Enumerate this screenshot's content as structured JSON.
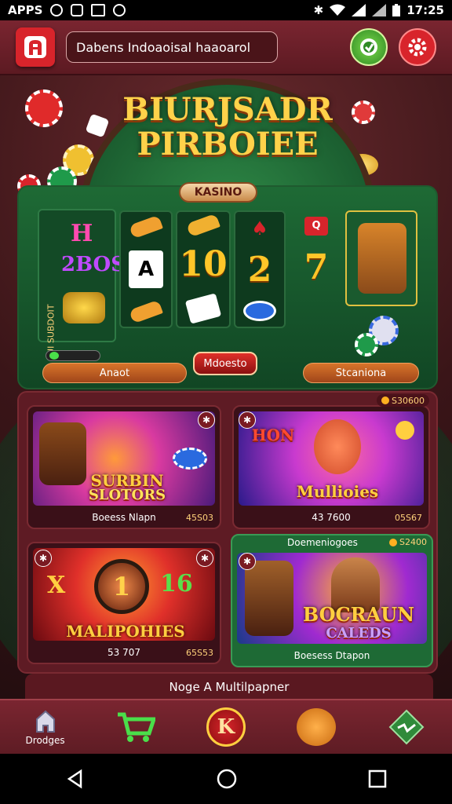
{
  "status_bar": {
    "left_text": "APPS",
    "time": "17:25"
  },
  "header": {
    "search_text": "Dabens Indoaoisal haaoarol"
  },
  "hero": {
    "title_line1": "BIURJSADR",
    "title_line2": "PIRBOIEE",
    "badge": "KASINO",
    "left_panel": {
      "row1": "H",
      "row2": "2BOS",
      "vertical": "BUI SUBDOIT"
    },
    "reels": [
      {
        "top": "",
        "mid": "A",
        "bottom": ""
      },
      {
        "top": "",
        "mid": "10",
        "bottom": ""
      },
      {
        "top": "",
        "mid": "2",
        "bottom": ""
      },
      {
        "top": "Q",
        "mid": "7",
        "bottom": ""
      }
    ],
    "left_button": "Anaot",
    "center_button": "Mdoesto",
    "right_button": "Stcaniona"
  },
  "games": [
    {
      "title_line1": "SURBIN",
      "title_line2": "SLOTORS",
      "caption": "Boeess Nlapn",
      "value": "45S03",
      "corner": "",
      "colors": [
        "#4a1a7a",
        "#d93aa0",
        "#ff8a2a"
      ]
    },
    {
      "title_line1": "HON",
      "title_line2": "Mullioies",
      "caption": "43 7600",
      "value": "05S67",
      "corner": "S30600",
      "colors": [
        "#2a1a8a",
        "#c93acf",
        "#ff4a8a"
      ]
    },
    {
      "title_line1": "",
      "title_line2": "MALIPOHIES",
      "caption": "53 707",
      "value": "65S53",
      "corner": "",
      "colors": [
        "#6a0a10",
        "#e0302a",
        "#ff9a30"
      ]
    },
    {
      "title_line1": "BOCRAUN",
      "title_line2": "CALEDS",
      "caption": "Boesess Dtapon",
      "value": "",
      "corner": "S2400",
      "header": "Doemeniogoes",
      "colors": [
        "#1a3a8a",
        "#a02ad0",
        "#ffb030"
      ]
    }
  ],
  "bottom_strip": {
    "label": "Noge A Multilpapner"
  },
  "tabs": [
    {
      "label": "Drodges",
      "icon": "home-icon"
    },
    {
      "label": "",
      "icon": "cart-icon"
    },
    {
      "label": "",
      "icon": "k-badge-icon"
    },
    {
      "label": "",
      "icon": "bear-icon"
    },
    {
      "label": "",
      "icon": "diamond-icon"
    }
  ]
}
